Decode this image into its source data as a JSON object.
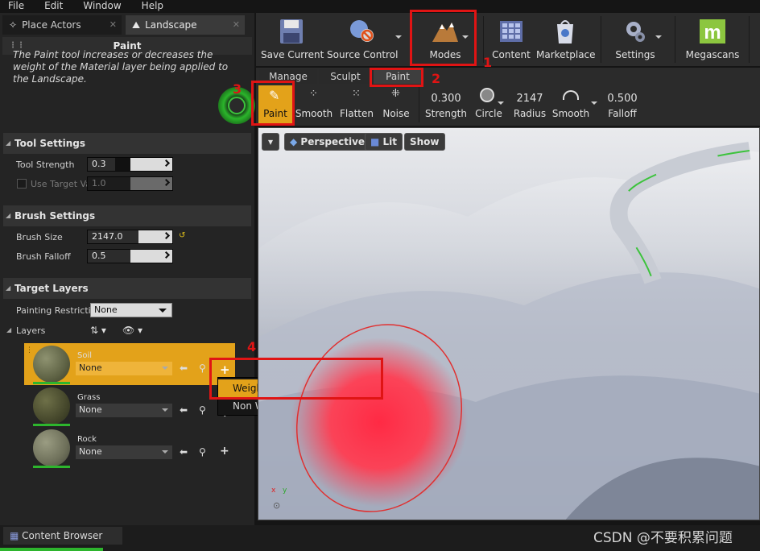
{
  "menu": [
    "File",
    "Edit",
    "Window",
    "Help"
  ],
  "left_tabs": {
    "place_actors": "Place Actors",
    "landscape": "Landscape"
  },
  "panel": {
    "title": "Paint",
    "description": "The Paint tool increases or decreases the weight of the Material layer being applied to the Landscape."
  },
  "tool_settings": {
    "header": "Tool Settings",
    "strength_label": "Tool Strength",
    "strength_value": "0.3",
    "use_target_label": "Use Target Va",
    "use_target_value": "1.0"
  },
  "brush_settings": {
    "header": "Brush Settings",
    "size_label": "Brush Size",
    "size_value": "2147.0",
    "falloff_label": "Brush Falloff",
    "falloff_value": "0.5"
  },
  "target_layers": {
    "header": "Target Layers",
    "restriction_label": "Painting Restricti",
    "restriction_value": "None",
    "layers_label": "Layers",
    "layers": [
      {
        "name": "Soil",
        "value": "None"
      },
      {
        "name": "Grass",
        "value": "None"
      },
      {
        "name": "Rock",
        "value": "None"
      }
    ]
  },
  "popup": {
    "item1": "Weight-Blended Layer (normal)",
    "item2": "Non Weight-Blended Layer"
  },
  "toolbar": {
    "save_current": "Save Current",
    "source_control": "Source Control",
    "modes": "Modes",
    "content": "Content",
    "marketplace": "Marketplace",
    "settings": "Settings",
    "megascans": "Megascans"
  },
  "mode_tabs": {
    "manage": "Manage",
    "sculpt": "Sculpt",
    "paint": "Paint"
  },
  "tools": {
    "paint": "Paint",
    "smooth": "Smooth",
    "flatten": "Flatten",
    "noise": "Noise",
    "strength_value": "0.300",
    "strength_label": "Strength",
    "circle_label": "Circle",
    "radius_value": "2147",
    "radius_label": "Radius",
    "smooth_label": "Smooth",
    "falloff_value": "0.500",
    "falloff_label": "Falloff"
  },
  "viewport": {
    "perspective": "Perspective",
    "lit": "Lit",
    "show": "Show"
  },
  "bottom": {
    "content_browser": "Content Browser"
  },
  "annotations": [
    "1",
    "2",
    "3",
    "4"
  ],
  "watermark": "CSDN @不要积累问题",
  "colors": {
    "accent_orange": "#e3a21a",
    "annotation_red": "#e01414",
    "mode_green": "#2db52d"
  }
}
